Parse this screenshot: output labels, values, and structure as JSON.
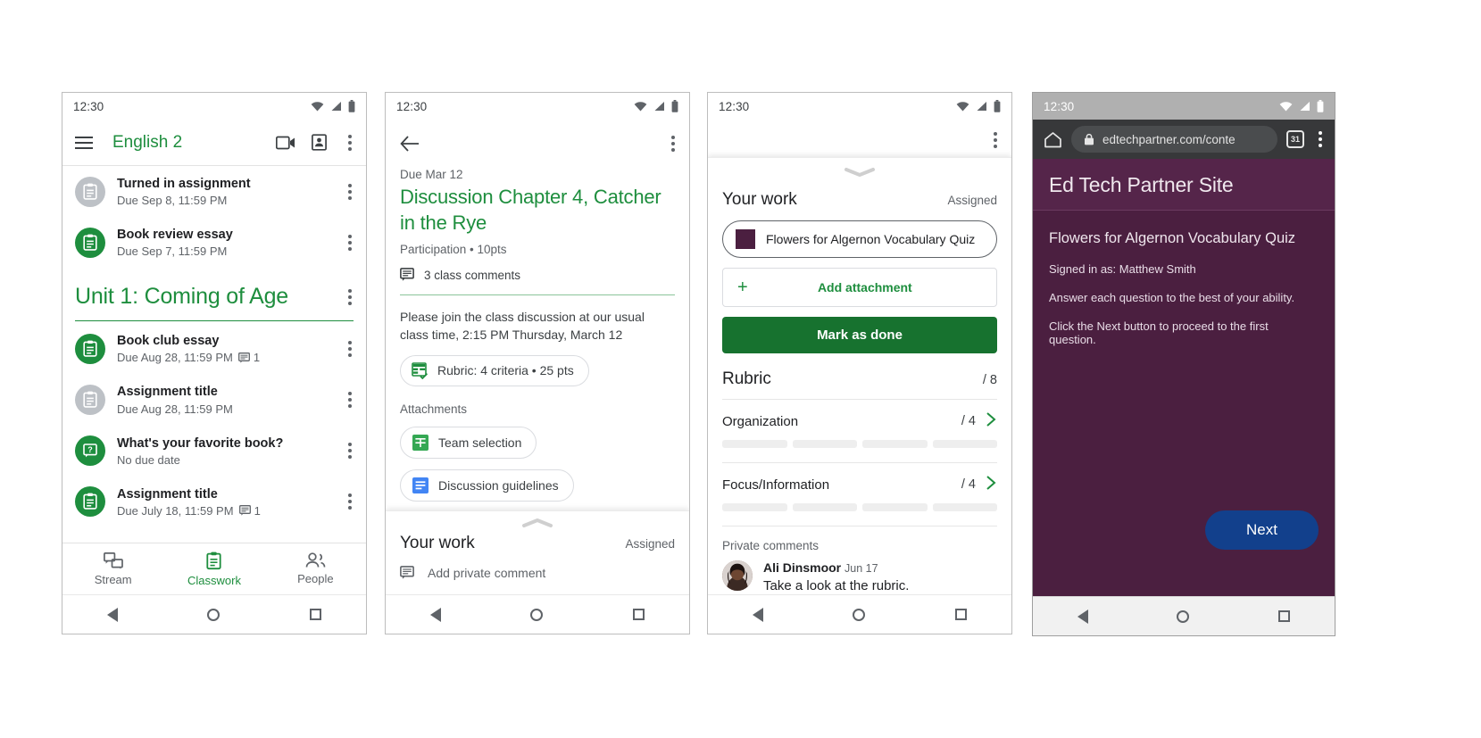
{
  "phone1": {
    "status": {
      "time": "12:30",
      "icons": [
        "wifi-icon",
        "signal-icon",
        "battery-icon"
      ]
    },
    "appbar": {
      "menu_icon": "hamburger-icon",
      "title": "English 2",
      "meet_icon": "video-camera-icon",
      "roster_icon": "class-card-icon",
      "overflow_icon": "kebab-icon"
    },
    "top_items": [
      {
        "title": "Turned in assignment",
        "subtitle": "Due Sep 8, 11:59 PM",
        "icon": "assignment-icon",
        "state": "grey",
        "comments": ""
      },
      {
        "title": "Book review essay",
        "subtitle": "Due Sep 7, 11:59 PM",
        "icon": "assignment-icon",
        "state": "green",
        "comments": ""
      }
    ],
    "unit": {
      "title": "Unit 1: Coming of Age",
      "overflow_icon": "kebab-icon"
    },
    "unit_items": [
      {
        "title": "Book club essay",
        "subtitle": "Due Aug 28, 11:59 PM",
        "icon": "assignment-icon",
        "state": "green",
        "comments": "1"
      },
      {
        "title": "Assignment title",
        "subtitle": "Due Aug 28, 11:59 PM",
        "icon": "assignment-icon",
        "state": "grey",
        "comments": ""
      },
      {
        "title": "What's your favorite book?",
        "subtitle": "No due date",
        "icon": "question-icon",
        "state": "green",
        "comments": ""
      },
      {
        "title": "Assignment title",
        "subtitle": "Due July 18, 11:59 PM",
        "icon": "assignment-icon",
        "state": "green",
        "comments": "1"
      }
    ],
    "tabs": [
      {
        "label": "Stream",
        "icon": "stream-icon",
        "active": false
      },
      {
        "label": "Classwork",
        "icon": "classwork-icon",
        "active": true
      },
      {
        "label": "People",
        "icon": "people-icon",
        "active": false
      }
    ]
  },
  "phone2": {
    "status": {
      "time": "12:30"
    },
    "back_icon": "back-arrow-icon",
    "overflow_icon": "kebab-icon",
    "due_label": "Due Mar 12",
    "title": "Discussion Chapter 4, Catcher in the Rye",
    "meta": "Participation • 10pts",
    "class_comments": "3 class comments",
    "body": "Please join the class discussion at our usual class time, 2:15 PM Thursday, March 12",
    "rubric_chip": "Rubric: 4 criteria • 25 pts",
    "attachments_label": "Attachments",
    "attachments": [
      {
        "label": "Team selection",
        "icon": "google-sheets-icon"
      },
      {
        "label": "Discussion guidelines",
        "icon": "google-docs-icon"
      }
    ],
    "sheet": {
      "handle_icon": "chevron-up-icon",
      "your_work": "Your work",
      "status": "Assigned",
      "private_comment_placeholder": "Add private comment",
      "comment_icon": "comment-icon"
    }
  },
  "phone3": {
    "status": {
      "time": "12:30"
    },
    "overflow_icon": "kebab-icon",
    "handle_icon": "chevron-down-icon",
    "your_work": "Your work",
    "work_status": "Assigned",
    "attachment_chip": {
      "label": "Flowers for Algernon Vocabulary Quiz",
      "swatch_color": "#4b1f40"
    },
    "add_attachment": "Add attachment",
    "add_attachment_icon": "plus-icon",
    "mark_done": "Mark as done",
    "rubric": {
      "title": "Rubric",
      "total": "/ 8",
      "criteria": [
        {
          "name": "Organization",
          "points": "/ 4",
          "chevron_icon": "chevron-right-icon",
          "segments": 4
        },
        {
          "name": "Focus/Information",
          "points": "/ 4",
          "chevron_icon": "chevron-right-icon",
          "segments": 4
        }
      ]
    },
    "private_comments": {
      "label": "Private comments",
      "comment": {
        "author": "Ali Dinsmoor",
        "date": "Jun 17",
        "text": "Take a look at the rubric.",
        "avatar": "user-avatar"
      }
    }
  },
  "phone4": {
    "status": {
      "time": "12:30"
    },
    "browser": {
      "home_icon": "home-icon",
      "lock_icon": "lock-icon",
      "url": "edtechpartner.com/conte",
      "tab_count": "31",
      "overflow_icon": "kebab-icon"
    },
    "site": {
      "header_title": "Ed Tech Partner Site",
      "quiz_title": "Flowers for Algernon Vocabulary Quiz",
      "lines": [
        "Signed in as: Matthew Smith",
        "Answer each question to the best of your ability.",
        "Click the Next button to proceed to the first question."
      ],
      "next_button": "Next",
      "bg_color": "#4b1f40",
      "button_color": "#12408c"
    }
  },
  "navbar": {
    "back_icon": "nav-back-triangle-icon",
    "home_icon": "nav-home-circle-icon",
    "recents_icon": "nav-recents-square-icon"
  }
}
